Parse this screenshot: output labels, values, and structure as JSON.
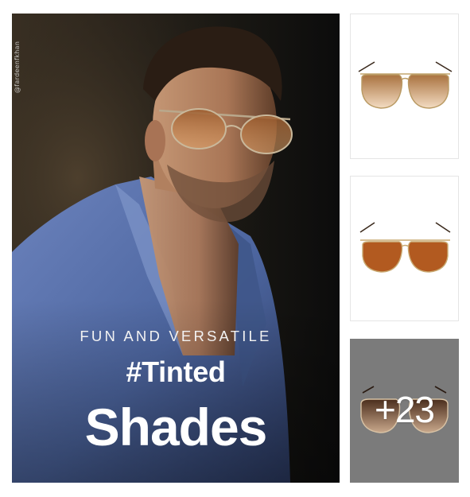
{
  "hero": {
    "watermark": "@fardeenfkhan",
    "tagline": "FUN AND VERSATILE",
    "hashtag": "#Tinted",
    "headline": "Shades"
  },
  "thumbnails": [
    {
      "icon": "gold-aviator-gradient-lens-icon"
    },
    {
      "icon": "gold-aviator-brown-lens-icon"
    },
    {
      "icon": "brown-aviator-icon",
      "overlay_text": "+23"
    }
  ],
  "colors": {
    "overlay_gray": "#7b7b7b",
    "jacket_blue": "#5b73ad",
    "lens_amber": "#c27a3a"
  }
}
